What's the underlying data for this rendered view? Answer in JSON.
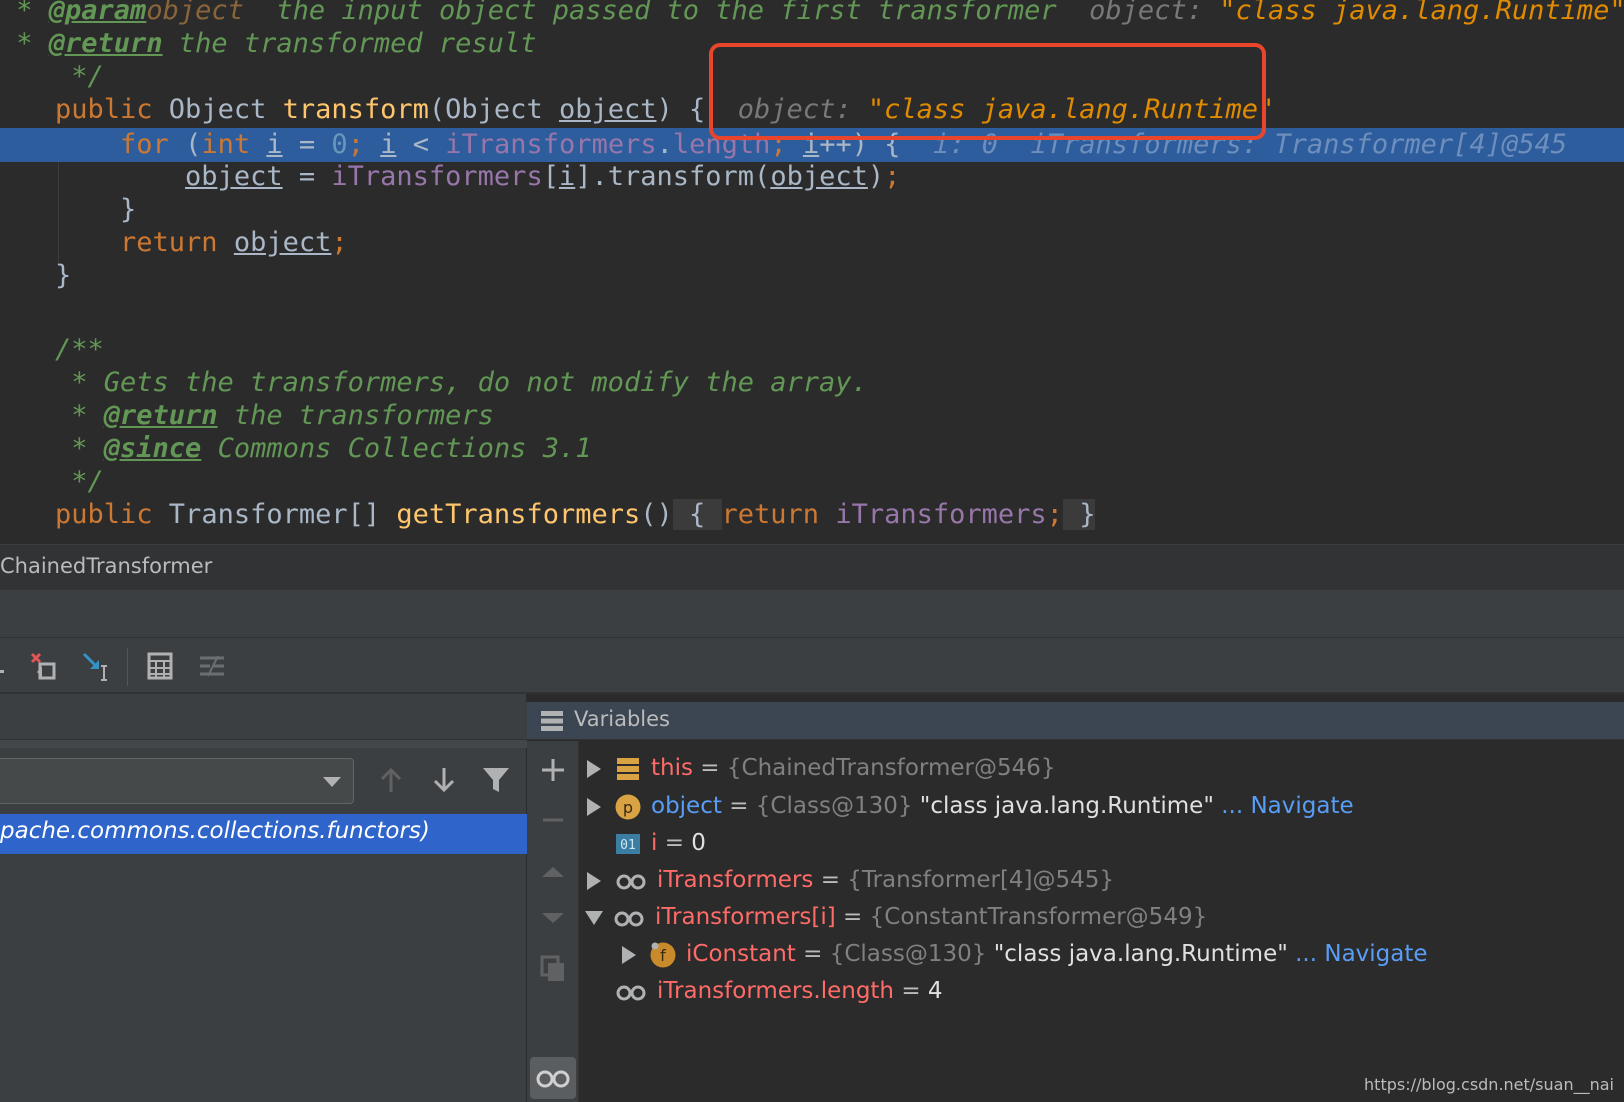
{
  "editor": {
    "line1": {
      "star": " * ",
      "tag": "@param",
      "param": "object",
      "text": "  the input object passed to the first transformer",
      "hint_label": "  object: ",
      "hint_value": "\"class java.lang.Runtime\""
    },
    "line2": {
      "star": " * ",
      "tag": "@return",
      "text": " the transformed result"
    },
    "line3": {
      "text": " */"
    },
    "line4": {
      "kw_public": "public",
      "type_object": " Object ",
      "method": "transform",
      "open": "(Object ",
      "param": "object",
      "close": ") {",
      "hint_label": "  object: ",
      "hint_value": "\"class java.lang.Runtime\""
    },
    "line5": {
      "indent": "    ",
      "kw_for": "for",
      "p1": " (",
      "kw_int": "int",
      "sp": " ",
      "var_i": "i",
      "eq": " = ",
      "zero": "0",
      "semi1": ";",
      "sp2": " ",
      "var_i2": "i",
      "lt": " < ",
      "field": "iTransformers",
      "dot": ".",
      "length": "length",
      "semi2": ";",
      "sp3": " ",
      "var_i3": "i",
      "inc": "++) {",
      "hint": "  i: 0  iTransformers: Transformer[4]@545"
    },
    "line6": {
      "indent": "        ",
      "var_obj": "object",
      "assign": " = ",
      "field": "iTransformers",
      "br1": "[",
      "var_i": "i",
      "br2": "].transform(",
      "var_obj2": "object",
      "end": ")",
      "semi": ";"
    },
    "line7": {
      "text": "    }"
    },
    "line8": {
      "indent": "    ",
      "kw_return": "return",
      "sp": " ",
      "var_obj": "object",
      "semi": ";"
    },
    "line9": {
      "text": "}"
    },
    "line11": {
      "text": "/**"
    },
    "line12": {
      "text": " * Gets the transformers, do not modify the array."
    },
    "line13": {
      "star": " * ",
      "tag": "@return",
      "text": " the transformers"
    },
    "line14": {
      "star": " * ",
      "tag": "@since",
      "text": " Commons Collections 3.1"
    },
    "line15": {
      "text": " */"
    },
    "line16": {
      "kw_public": "public",
      "type": " Transformer[] ",
      "method": "getTransformers",
      "parens": "()",
      "fold_open": " { ",
      "kw_return": "return",
      "sp": " ",
      "field": "iTransformers",
      "semi": ";",
      "fold_close": " }"
    }
  },
  "breadcrumb": {
    "label": "ChainedTransformer"
  },
  "frames": {
    "selected_frame": "pache.commons.collections.functors)"
  },
  "variables": {
    "title": "Variables",
    "rows": [
      {
        "name": "this",
        "eq": " = ",
        "type": "{ChainedTransformer@546}",
        "value": "",
        "nav": ""
      },
      {
        "name": "object",
        "eq": " = ",
        "type": "{Class@130}",
        "value": " \"class java.lang.Runtime\"",
        "nav": " ... Navigate"
      },
      {
        "name": "i",
        "eq": " = ",
        "type": "",
        "value": "0",
        "nav": ""
      },
      {
        "name": "iTransformers",
        "eq": " = ",
        "type": "{Transformer[4]@545}",
        "value": "",
        "nav": ""
      },
      {
        "name": "iTransformers[i]",
        "eq": " = ",
        "type": "{ConstantTransformer@549}",
        "value": "",
        "nav": ""
      },
      {
        "name": "iConstant",
        "eq": " = ",
        "type": "{Class@130}",
        "value": " \"class java.lang.Runtime\"",
        "nav": " ... Navigate"
      },
      {
        "name": "iTransformers.length",
        "eq": " = ",
        "type": "",
        "value": "4",
        "nav": ""
      }
    ]
  },
  "watermark": "https://blog.csdn.net/suan__nai",
  "colors": {
    "keyword": "#cc7832",
    "method": "#ffc66d",
    "field": "#9876aa",
    "number": "#6897bb",
    "doc_comment": "#629755",
    "execution_line": "#2d5d9c",
    "highlight_box": "#e8452c",
    "variable_name": "#ff6b68",
    "navigate_link": "#589df6",
    "selected_frame": "#2f65ca"
  }
}
